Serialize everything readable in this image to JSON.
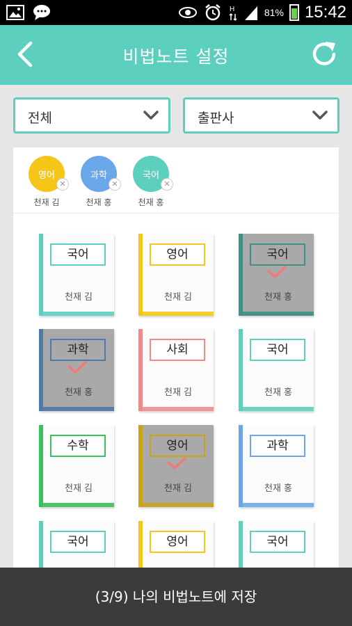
{
  "status_bar": {
    "icons": [
      "image-icon",
      "chat-icon",
      "eye-icon",
      "alarm-icon",
      "hspa-icon",
      "signal-icon"
    ],
    "battery": "81%",
    "time": "15:42",
    "battery_color": "#69d14b"
  },
  "app_bar": {
    "title": "비법노트 설정",
    "back_icon": "back-arrow-icon",
    "refresh_icon": "refresh-icon",
    "color": "#5ccfbe"
  },
  "filters": {
    "filter1": "전체",
    "filter2": "출판사"
  },
  "selected": [
    {
      "subject": "영어",
      "name": "천재 김",
      "color": "#f5c518"
    },
    {
      "subject": "과학",
      "name": "천재 홍",
      "color": "#6aa7e8"
    },
    {
      "subject": "국어",
      "name": "천재 홍",
      "color": "#5ccfbe"
    }
  ],
  "books": [
    {
      "subject": "국어",
      "name": "천재 김",
      "color": "#5ccfbe",
      "selected": false
    },
    {
      "subject": "영어",
      "name": "천재 김",
      "color": "#f5c518",
      "selected": false
    },
    {
      "subject": "국어",
      "name": "천재 홍",
      "color": "#3f8f84",
      "selected": true
    },
    {
      "subject": "과학",
      "name": "천재 홍",
      "color": "#4f79a8",
      "selected": true
    },
    {
      "subject": "사회",
      "name": "천재 김",
      "color": "#f08a8a",
      "selected": false
    },
    {
      "subject": "국어",
      "name": "천재 홍",
      "color": "#5ccfbe",
      "selected": false
    },
    {
      "subject": "수학",
      "name": "천재 김",
      "color": "#3bbf5a",
      "selected": false
    },
    {
      "subject": "영어",
      "name": "천재 김",
      "color": "#c9a417",
      "selected": true
    },
    {
      "subject": "과학",
      "name": "천재 홍",
      "color": "#6aa7e8",
      "selected": false
    },
    {
      "subject": "국어",
      "name": "",
      "color": "#5ccfbe",
      "selected": false
    },
    {
      "subject": "영어",
      "name": "",
      "color": "#f5c518",
      "selected": false
    },
    {
      "subject": "국어",
      "name": "",
      "color": "#5ccfbe",
      "selected": false
    }
  ],
  "toast": {
    "text": "(3/9) 나의 비법노트에 저장"
  },
  "check_color": "#f07a7a"
}
